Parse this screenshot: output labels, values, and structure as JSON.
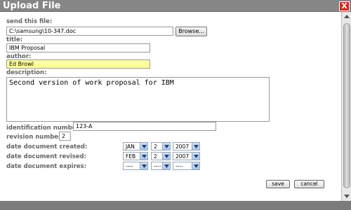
{
  "window": {
    "title": "Upload File",
    "close_label": "X"
  },
  "form": {
    "send_file": {
      "label": "send this file:",
      "value": "C:\\samsung\\10-347.doc",
      "browse_label": "Browse..."
    },
    "title": {
      "label": "title:",
      "value": "IBM Proposal"
    },
    "author": {
      "label": "author:",
      "value": "Ed Browl"
    },
    "description": {
      "label": "description:",
      "value": "Second version of work proposal for IBM"
    },
    "identification": {
      "label": "identification number:",
      "value": "123-A"
    },
    "revision": {
      "label": "revision number:",
      "value": "2"
    },
    "created": {
      "label": "date document created:",
      "month": "JAN",
      "day": "2",
      "year": "2007"
    },
    "revised": {
      "label": "date document revised:",
      "month": "FEB",
      "day": "2",
      "year": "2007"
    },
    "expires": {
      "label": "date document expires:",
      "month": "----",
      "day": "----",
      "year": "----"
    }
  },
  "buttons": {
    "save": "save",
    "cancel": "cancel"
  },
  "colors": {
    "titlebar": "#868686",
    "close": "#e0211b",
    "author_highlight": "#ffff99",
    "footer": "#7b7b7b"
  }
}
